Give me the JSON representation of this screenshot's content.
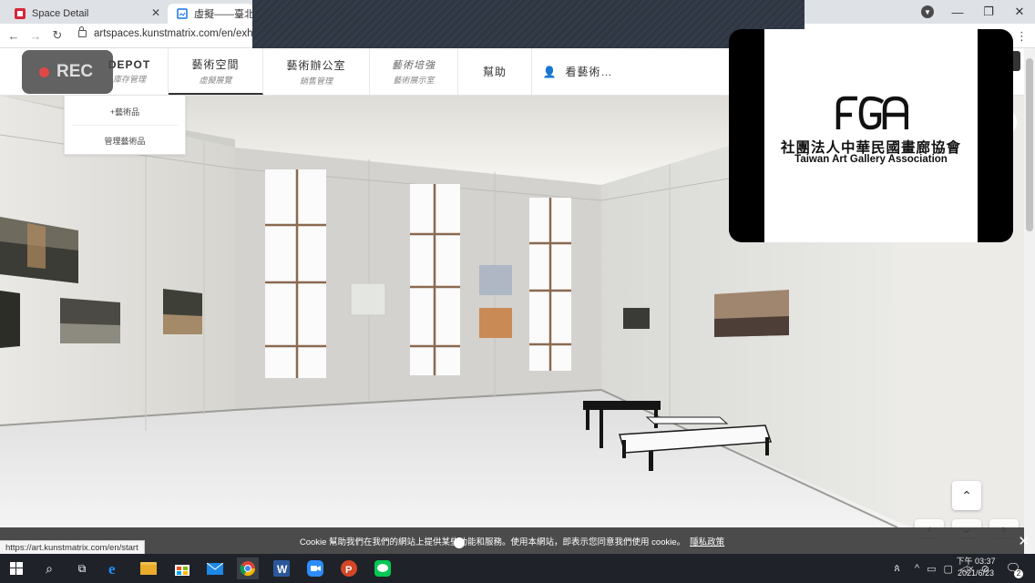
{
  "browser": {
    "tabs": [
      {
        "label": "Space Detail",
        "active": false
      },
      {
        "label": "虛擬——臺北京…",
        "active": true
      }
    ],
    "address_url": "artspaces.kunstmatrix.com/en/exhi",
    "status_url": "https://art.kunstmatrix.com/en/start"
  },
  "recorder": {
    "label": "REC"
  },
  "site_nav": {
    "items": [
      {
        "title": "DEPOT",
        "subtitle": "庫存管理"
      },
      {
        "title": "藝術空間",
        "subtitle": "虛擬展覽"
      },
      {
        "title": "藝術辦公室",
        "subtitle": "銷售管理"
      },
      {
        "title": "藝術培強",
        "subtitle": "藝術展示室"
      },
      {
        "title": "幫助",
        "subtitle": ""
      },
      {
        "title": "看藝術…",
        "subtitle": ""
      }
    ],
    "dropdown": [
      "+藝術品",
      "管理藝術品"
    ]
  },
  "logo": {
    "mark": "AGA",
    "name_zh": "社團法人中華民國畫廊協會",
    "name_en": "Taiwan Art Gallery Association"
  },
  "cookie_bar": {
    "text": "Cookie 幫助我們在我們的網站上提供某些功能和服務。使用本網站，即表示您同意我們使用 cookie。",
    "link": "隱私政策"
  },
  "taskbar": {
    "time": "下午 03:37",
    "date": "2021/6/23",
    "notification_count": "2"
  },
  "colors": {
    "taskbar": "#1f2329",
    "tab_bar": "#dee1e6",
    "rec_dot": "#e04848"
  }
}
